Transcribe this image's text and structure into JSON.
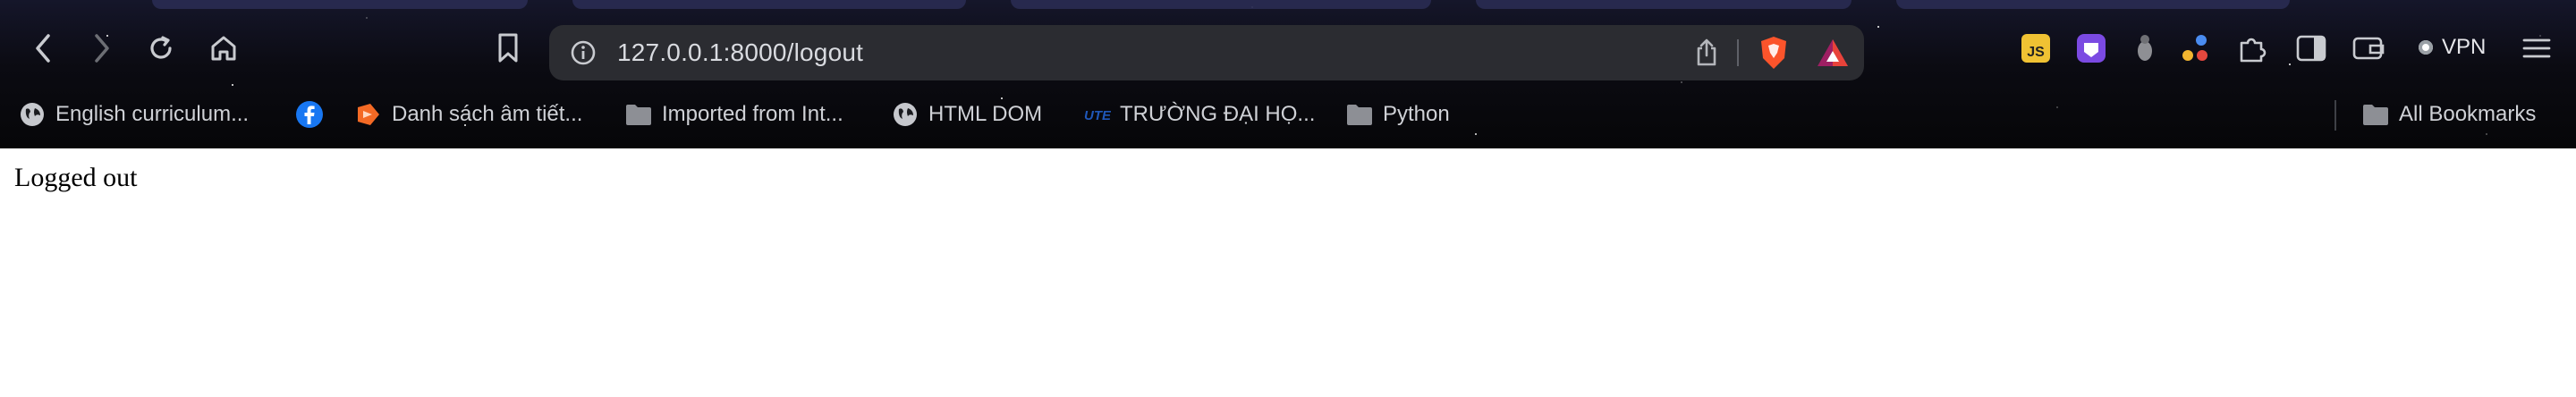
{
  "browser": {
    "url": "127.0.0.1:8000/logout",
    "vpn_label": "VPN",
    "accent": "#fb542b",
    "toolbar_icons": [
      "back-icon",
      "forward-icon",
      "reload-icon",
      "home-icon",
      "bookmark-icon",
      "info-icon",
      "share-icon",
      "brave-shields-icon",
      "brave-rewards-icon"
    ],
    "extensions": [
      "js-extension-icon",
      "purple-extension-icon",
      "bug-extension-icon",
      "dots-extension-icon",
      "puzzle-extensions-icon",
      "sidebar-icon",
      "wallet-icon",
      "menu-icon"
    ]
  },
  "bookmarks": {
    "items": [
      {
        "label": "English curriculum...",
        "icon": "globe-icon"
      },
      {
        "label": "",
        "icon": "facebook-icon"
      },
      {
        "label": "Danh sách âm tiết...",
        "icon": "orange-logo-icon"
      },
      {
        "label": "Imported from Int...",
        "icon": "folder-icon"
      },
      {
        "label": "HTML DOM",
        "icon": "globe-icon"
      },
      {
        "label": "TRƯỜNG ĐẠI HỌ...",
        "icon": "ute-logo-icon"
      },
      {
        "label": "Python",
        "icon": "folder-icon"
      }
    ],
    "all_bookmarks": "All Bookmarks"
  },
  "page": {
    "body_text": "Logged out"
  }
}
